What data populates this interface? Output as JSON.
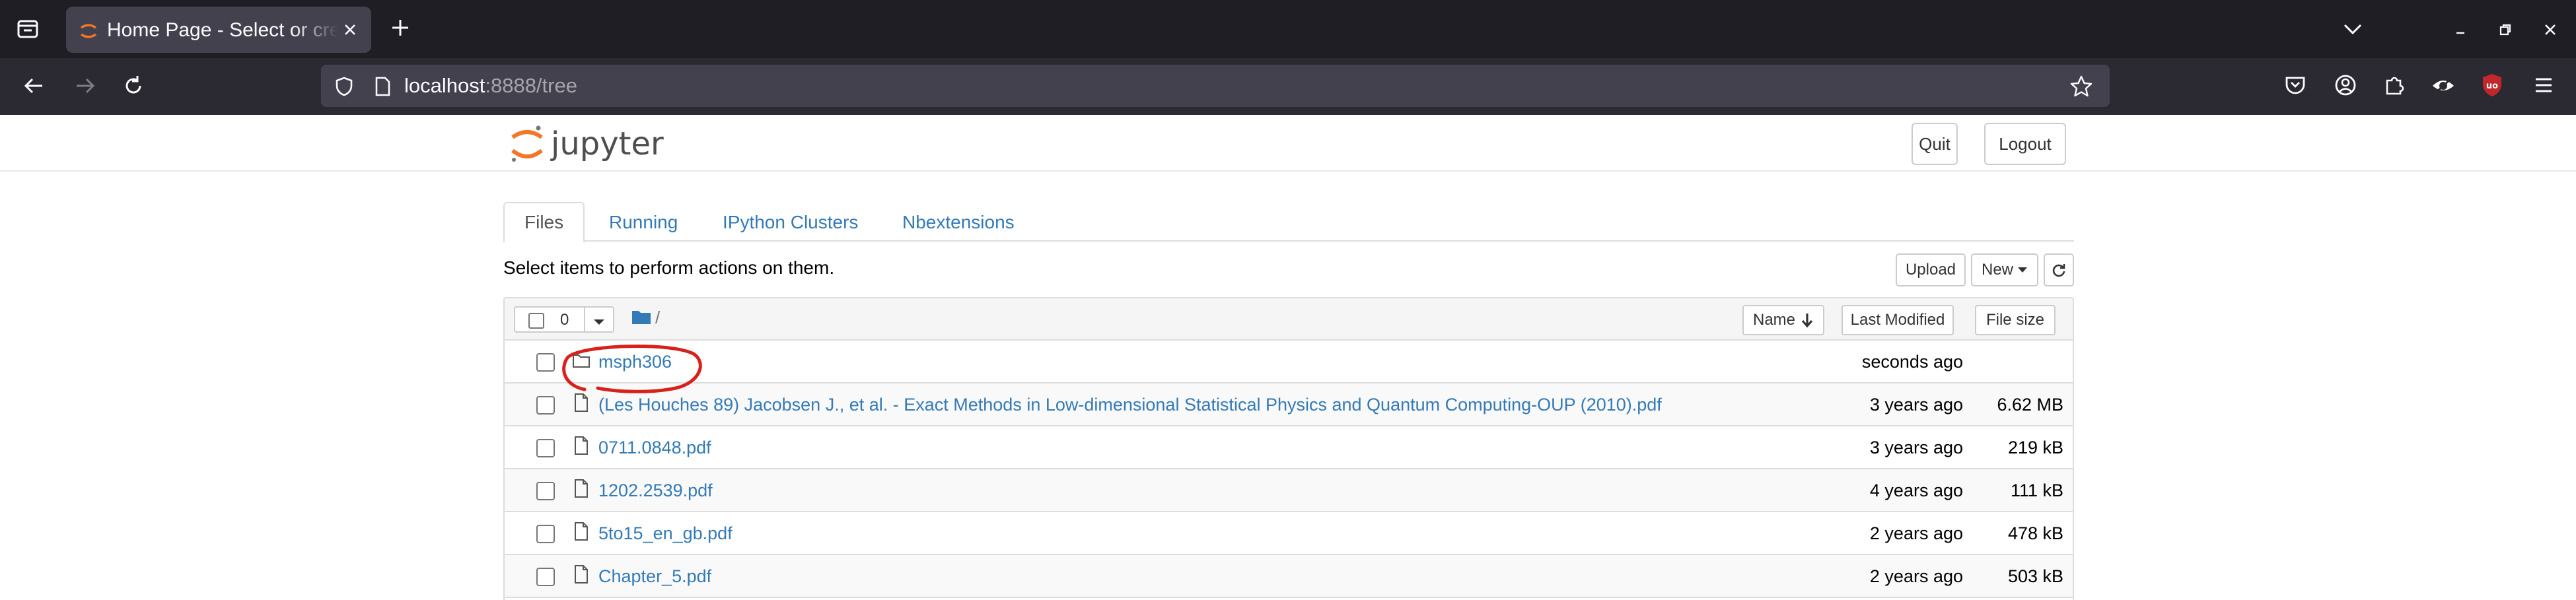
{
  "browser": {
    "tab_title": "Home Page - Select or create a notebook",
    "url_host": "localhost",
    "url_rest": ":8888/tree",
    "colors": {
      "tabbar": "#1f1e25",
      "navbar": "#2b2a33",
      "urlbar": "#42414d",
      "ublock": "#c1272d"
    }
  },
  "jupyter": {
    "logo_text": "jupyter",
    "header_buttons": {
      "quit": "Quit",
      "logout": "Logout"
    },
    "tabs": [
      {
        "label": "Files",
        "active": true
      },
      {
        "label": "Running",
        "active": false
      },
      {
        "label": "IPython Clusters",
        "active": false
      },
      {
        "label": "Nbextensions",
        "active": false
      }
    ],
    "select_hint": "Select items to perform actions on them.",
    "toolbar": {
      "upload": "Upload",
      "new": "New"
    },
    "list_header": {
      "selected_count": "0",
      "breadcrumb_sep": "/",
      "col_name": "Name",
      "col_modified": "Last Modified",
      "col_size": "File size"
    },
    "files": [
      {
        "type": "folder",
        "name": "msph306",
        "modified": "seconds ago",
        "size": ""
      },
      {
        "type": "file",
        "name": "(Les Houches 89) Jacobsen J., et al. - Exact Methods in Low-dimensional Statistical Physics and Quantum Computing-OUP (2010).pdf",
        "modified": "3 years ago",
        "size": "6.62 MB"
      },
      {
        "type": "file",
        "name": "0711.0848.pdf",
        "modified": "3 years ago",
        "size": "219 kB"
      },
      {
        "type": "file",
        "name": "1202.2539.pdf",
        "modified": "4 years ago",
        "size": "111 kB"
      },
      {
        "type": "file",
        "name": "5to15_en_gb.pdf",
        "modified": "2 years ago",
        "size": "478 kB"
      },
      {
        "type": "file",
        "name": "Chapter_5.pdf",
        "modified": "2 years ago",
        "size": "503 kB"
      }
    ],
    "colors": {
      "link": "#337ab7",
      "logo_orange": "#f37726",
      "annotation": "#d9211c"
    }
  }
}
